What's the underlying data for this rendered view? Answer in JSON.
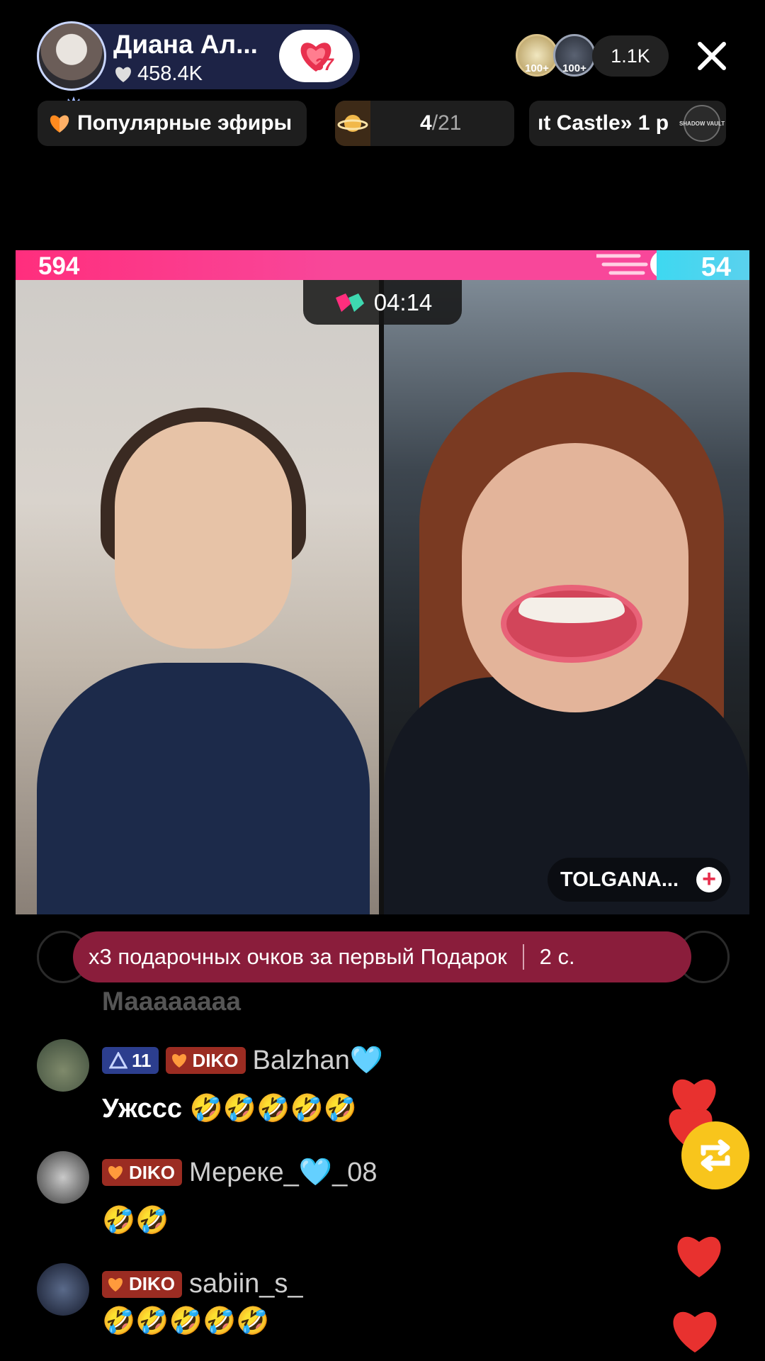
{
  "host": {
    "name": "Диана Ал...",
    "likes": "458.4K",
    "badge_number": "37"
  },
  "viewers": {
    "avatar_labels": [
      "100+",
      "100+"
    ],
    "count": "1.1K"
  },
  "chips": {
    "popular": "Популярные эфиры",
    "rank_current": "4",
    "rank_total": "/21",
    "castle": "ıt Castle» 1 р",
    "vault_label": "SHADOW VAULT"
  },
  "battle": {
    "score_left": "594",
    "score_right": "54",
    "timer": "04:14",
    "opponent_name": "TOLGANA..."
  },
  "banner": {
    "text": "x3 подарочных очков за первый Подарок",
    "countdown": "2 с."
  },
  "comments": {
    "ghost_text": "Маааааааа",
    "items": [
      {
        "level": "11",
        "fan_badge": "DIKO",
        "user": "Balzhan🩵",
        "text": "Ужсcс 🤣🤣🤣🤣🤣"
      },
      {
        "fan_badge": "DIKO",
        "user": "Мереке_🩵_08",
        "text": "🤣🤣"
      },
      {
        "fan_badge": "DIKO",
        "user": "sabiin_s_",
        "text": "🤣🤣🤣🤣🤣"
      }
    ]
  },
  "colors": {
    "accent_pink": "#ff2e7d",
    "accent_cyan": "#3ed8f0",
    "banner": "#8a1d3b",
    "share": "#f8c51c",
    "heart": "#e8312f"
  }
}
